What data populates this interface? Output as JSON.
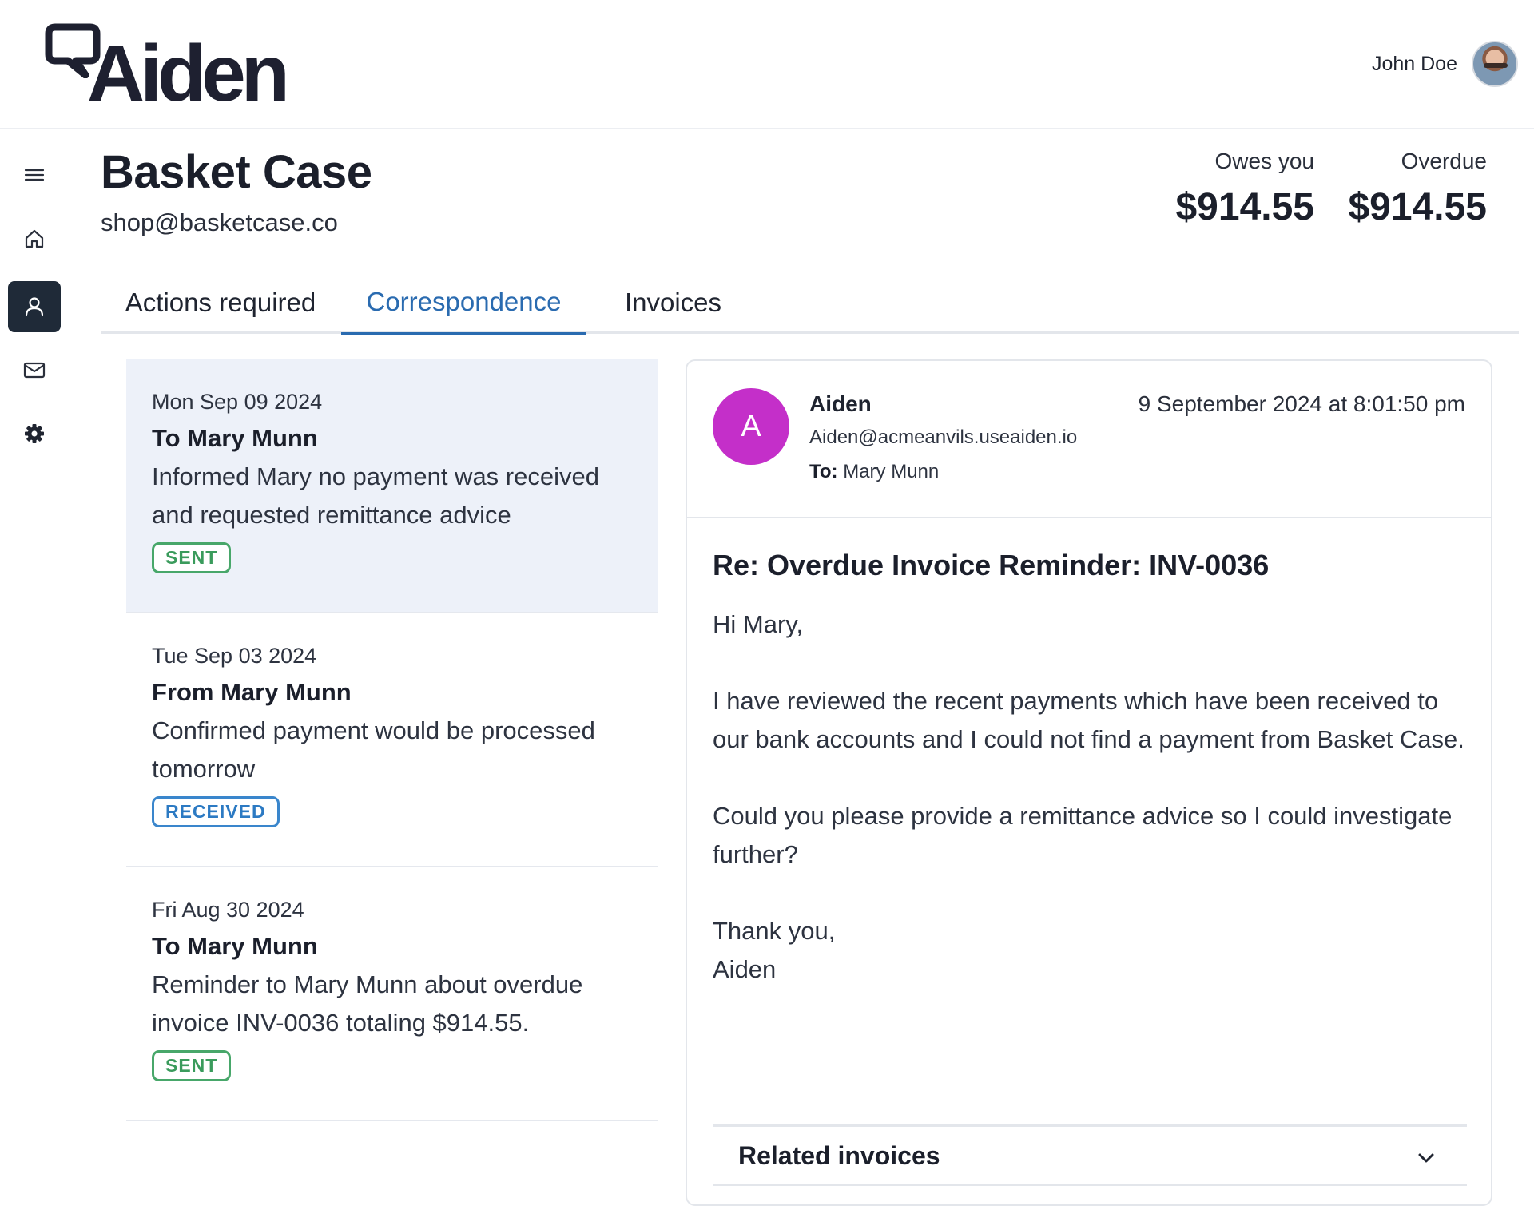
{
  "app": {
    "logo_text": "Aiden",
    "user_name": "John Doe"
  },
  "sidebar": {
    "items": [
      {
        "name": "menu",
        "icon": "menu-icon",
        "active": false
      },
      {
        "name": "home",
        "icon": "home-icon",
        "active": false
      },
      {
        "name": "contacts",
        "icon": "user-icon",
        "active": true
      },
      {
        "name": "mail",
        "icon": "mail-icon",
        "active": false
      },
      {
        "name": "settings",
        "icon": "gear-icon",
        "active": false
      }
    ]
  },
  "customer": {
    "name": "Basket Case",
    "email": "shop@basketcase.co"
  },
  "stats": {
    "owes_label": "Owes you",
    "owes_value": "$914.55",
    "overdue_label": "Overdue",
    "overdue_value": "$914.55"
  },
  "tabs": [
    {
      "label": "Actions required",
      "active": false
    },
    {
      "label": "Correspondence",
      "active": true
    },
    {
      "label": "Invoices",
      "active": false
    }
  ],
  "correspondence": [
    {
      "date": "Mon Sep 09 2024",
      "title": "To Mary Munn",
      "description": "Informed Mary no payment was received and requested remittance advice",
      "status": "SENT",
      "selected": true
    },
    {
      "date": "Tue Sep 03 2024",
      "title": "From Mary Munn",
      "description": "Confirmed payment would be processed tomorrow",
      "status": "RECEIVED",
      "selected": false
    },
    {
      "date": "Fri Aug 30 2024",
      "title": "To Mary Munn",
      "description": "Reminder to Mary Munn about overdue invoice INV-0036 totaling $914.55.",
      "status": "SENT",
      "selected": false
    }
  ],
  "message": {
    "avatar_letter": "A",
    "sender_name": "Aiden",
    "sender_email": "Aiden@acmeanvils.useaiden.io",
    "to_label": "To:",
    "to_name": "Mary Munn",
    "sent_time": "9 September 2024 at 8:01:50 pm",
    "subject": "Re: Overdue Invoice Reminder: INV-0036",
    "greeting": "Hi Mary,",
    "paragraph_1": "I have reviewed the recent payments which have been received to our bank accounts and I could not find a payment from Basket Case.",
    "paragraph_2": "Could you please provide a remittance advice so I could investigate further?",
    "signoff": "Thank you,",
    "signature": "Aiden",
    "related_label": "Related invoices"
  },
  "colors": {
    "accent": "#2a6bb0",
    "sidebar_active": "#1f2a38",
    "sender_avatar": "#c42fc9",
    "sent_badge": "#48a76a",
    "received_badge": "#3a86cc",
    "selected_row": "#edf1f9"
  }
}
